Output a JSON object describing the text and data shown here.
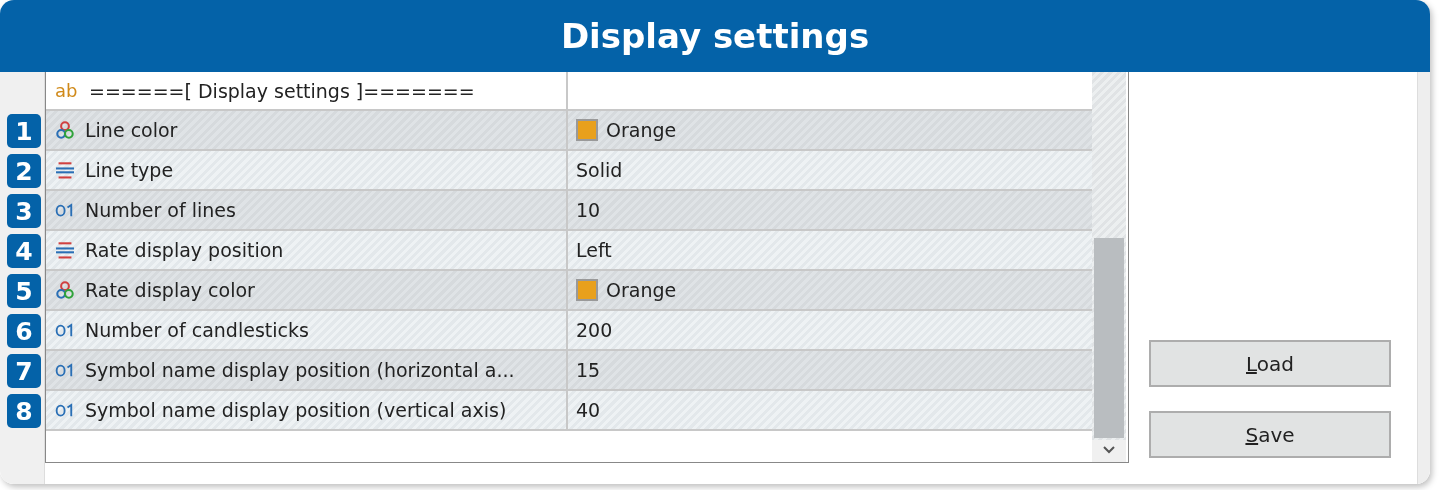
{
  "window": {
    "title": "Display settings"
  },
  "section_header": {
    "kind": "string",
    "type_icon": "ab",
    "label": "======[ Display settings ]======="
  },
  "rows": [
    {
      "number": "1",
      "kind": "color",
      "name": "Line color",
      "value": "Orange",
      "color": "#e8a01c"
    },
    {
      "number": "2",
      "kind": "enum",
      "name": "Line type",
      "value": "Solid"
    },
    {
      "number": "3",
      "kind": "number",
      "name": "Number of lines",
      "value": "10"
    },
    {
      "number": "4",
      "kind": "enum",
      "name": "Rate display position",
      "value": "Left"
    },
    {
      "number": "5",
      "kind": "color",
      "name": "Rate display color",
      "value": "Orange",
      "color": "#e8a01c"
    },
    {
      "number": "6",
      "kind": "number",
      "name": "Number of candlesticks",
      "value": "200"
    },
    {
      "number": "7",
      "kind": "number",
      "name": "Symbol name display position (horizontal a...",
      "value": "15"
    },
    {
      "number": "8",
      "kind": "number",
      "name": "Symbol name display position (vertical axis)",
      "value": "40"
    }
  ],
  "buttons": [
    {
      "label": "Load",
      "underline_first": true
    },
    {
      "label": "Save",
      "underline_first": true
    }
  ]
}
